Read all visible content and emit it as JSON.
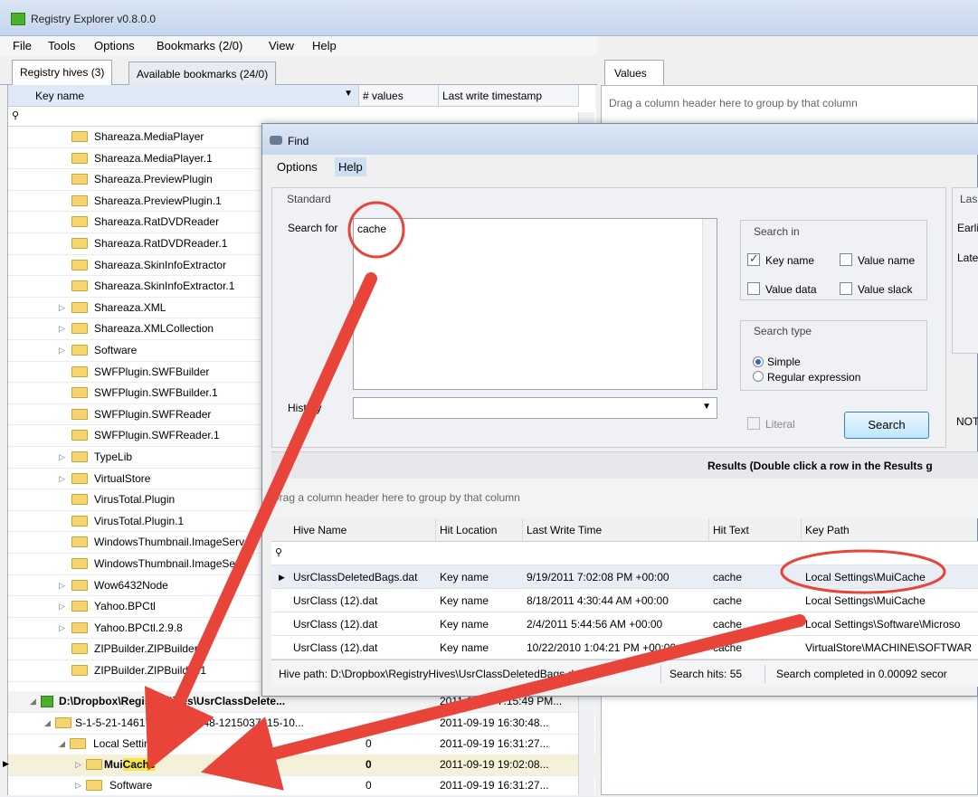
{
  "window": {
    "title": "Registry Explorer v0.8.0.0"
  },
  "menu": {
    "file": "File",
    "tools": "Tools",
    "options": "Options",
    "bookmarks": "Bookmarks (2/0)",
    "view": "View",
    "help": "Help"
  },
  "tabs": {
    "hives": "Registry hives (3)",
    "bookmarks": "Available bookmarks (24/0)"
  },
  "grid": {
    "col_key": "Key name",
    "col_values": "# values",
    "col_ts": "Last write timestamp",
    "rows": [
      {
        "name": "Shareaza.MediaPlayer",
        "exp": false
      },
      {
        "name": "Shareaza.MediaPlayer.1",
        "exp": false
      },
      {
        "name": "Shareaza.PreviewPlugin",
        "exp": false
      },
      {
        "name": "Shareaza.PreviewPlugin.1",
        "exp": false
      },
      {
        "name": "Shareaza.RatDVDReader",
        "exp": false
      },
      {
        "name": "Shareaza.RatDVDReader.1",
        "exp": false
      },
      {
        "name": "Shareaza.SkinInfoExtractor",
        "exp": false
      },
      {
        "name": "Shareaza.SkinInfoExtractor.1",
        "exp": false
      },
      {
        "name": "Shareaza.XML",
        "exp": true
      },
      {
        "name": "Shareaza.XMLCollection",
        "exp": true
      },
      {
        "name": "Software",
        "exp": true
      },
      {
        "name": "SWFPlugin.SWFBuilder",
        "exp": false
      },
      {
        "name": "SWFPlugin.SWFBuilder.1",
        "exp": false
      },
      {
        "name": "SWFPlugin.SWFReader",
        "exp": false
      },
      {
        "name": "SWFPlugin.SWFReader.1",
        "exp": false
      },
      {
        "name": "TypeLib",
        "exp": true
      },
      {
        "name": "VirtualStore",
        "exp": true
      },
      {
        "name": "VirusTotal.Plugin",
        "exp": false
      },
      {
        "name": "VirusTotal.Plugin.1",
        "exp": false
      },
      {
        "name": "WindowsThumbnail.ImageServ",
        "exp": false
      },
      {
        "name": "WindowsThumbnail.ImageServ",
        "exp": false
      },
      {
        "name": "Wow6432Node",
        "exp": true
      },
      {
        "name": "Yahoo.BPCtl",
        "exp": true
      },
      {
        "name": "Yahoo.BPCtl.2.9.8",
        "exp": true
      },
      {
        "name": "ZIPBuilder.ZIPBuilder",
        "exp": false
      },
      {
        "name": "ZIPBuilder.ZIPBuilder.1",
        "exp": false
      }
    ],
    "hive_row": {
      "name": "D:\\Dropbox\\RegistryHives\\UsrClassDelete...",
      "ts": "2011-09-19 7:15:49 PM..."
    },
    "sid_row": {
      "name": "S-1-5-21-1461751-63468248-1215037915-10...",
      "ts": "2011-09-19 16:30:48..."
    },
    "local_row": {
      "name": "Local Settings",
      "cnt": "0",
      "ts": "2011-09-19 16:31:27..."
    },
    "mui_row": {
      "prefix": "Mui",
      "highlight": "Cache",
      "cnt": "0",
      "ts": "2011-09-19 19:02:08..."
    },
    "soft_row": {
      "name": "Software",
      "cnt": "0",
      "ts": "2011-09-19 16:31:27..."
    }
  },
  "values_pane": {
    "tab": "Values",
    "hint": "Drag a column header here to group by that column"
  },
  "find": {
    "title": "Find",
    "menu_options": "Options",
    "menu_help": "Help",
    "standard_label": "Standard",
    "search_for_label": "Search for",
    "search_value": "cache",
    "history_label": "History",
    "search_in_label": "Search in",
    "key_name": "Key name",
    "value_name": "Value name",
    "value_data": "Value data",
    "value_slack": "Value slack",
    "search_type_label": "Search type",
    "simple": "Simple",
    "regex": "Regular expression",
    "literal": "Literal",
    "search_button": "Search",
    "last_label": "Las",
    "earliest": "Earli",
    "latest": "Late",
    "note": "NOT",
    "results_title": "Results (Double click a row in the Results g",
    "group_hint": "Drag a column header here to group by that column",
    "cols": {
      "hive": "Hive Name",
      "hit": "Hit Location",
      "lwt": "Last Write Time",
      "text": "Hit Text",
      "path": "Key Path"
    },
    "results": [
      {
        "hive": "UsrClassDeletedBags.dat",
        "hit": "Key name",
        "lwt": "9/19/2011 7:02:08 PM +00:00",
        "text": "cache",
        "path": "Local Settings\\MuiCache"
      },
      {
        "hive": "UsrClass (12).dat",
        "hit": "Key name",
        "lwt": "8/18/2011 4:30:44 AM +00:00",
        "text": "cache",
        "path": "Local Settings\\MuiCache"
      },
      {
        "hive": "UsrClass (12).dat",
        "hit": "Key name",
        "lwt": "2/4/2011 5:44:56 AM +00:00",
        "text": "cache",
        "path": "Local Settings\\Software\\Microso"
      },
      {
        "hive": "UsrClass (12).dat",
        "hit": "Key name",
        "lwt": "10/22/2010 1:04:21 PM +00:00",
        "text": "cache",
        "path": "VirtualStore\\MACHINE\\SOFTWAR"
      }
    ],
    "status_path": "Hive path: D:\\Dropbox\\RegistryHives\\UsrClassDeletedBags.dat",
    "status_hits": "Search hits: 55",
    "status_time": "Search completed in 0.00092 secor"
  },
  "colors": {
    "annotation": "#e8443a",
    "highlight": "#f5e64a"
  }
}
